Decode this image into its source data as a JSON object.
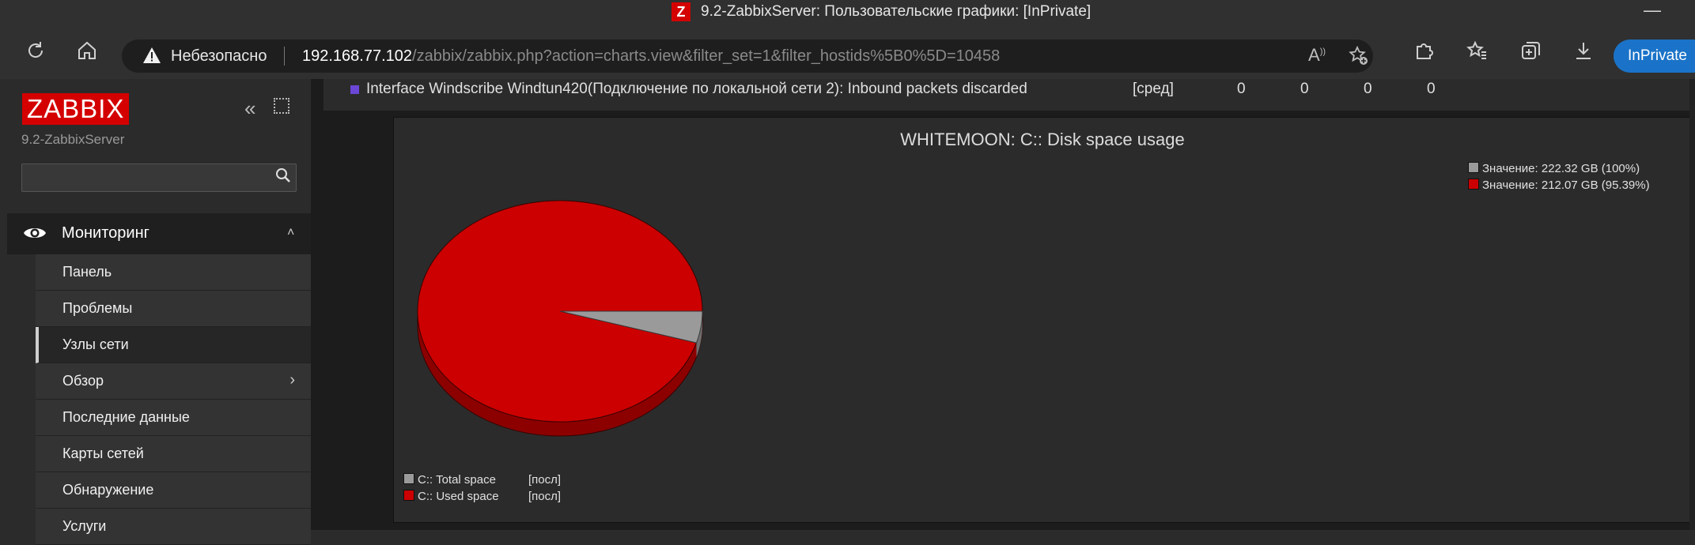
{
  "browser": {
    "window_title": "9.2-ZabbixServer: Пользовательские графики: [InPrivate]",
    "security_label": "Небезопасно",
    "url_host": "192.168.77.102",
    "url_path": "/zabbix/zabbix.php?action=charts.view&filter_set=1&filter_hostids%5B0%5D=10458",
    "inprivate_label": "InPrivate"
  },
  "sidebar": {
    "logo": "ZABBIX",
    "server_name": "9.2-ZabbixServer",
    "search_value": "",
    "section_label": "Мониторинг",
    "items": [
      {
        "label": "Панель"
      },
      {
        "label": "Проблемы"
      },
      {
        "label": "Узлы сети"
      },
      {
        "label": "Обзор"
      },
      {
        "label": "Последние данные"
      },
      {
        "label": "Карты сетей"
      },
      {
        "label": "Обнаружение"
      },
      {
        "label": "Услуги"
      }
    ]
  },
  "top_row": {
    "item_name": "Interface Windscribe Windtun420(Подключение по локальной сети 2): Inbound packets discarded",
    "aggregation": "[сред]",
    "values": [
      "0",
      "0",
      "0",
      "0"
    ]
  },
  "chart_data": {
    "type": "pie",
    "title": "WHITEMOON: C:: Disk space usage",
    "units": "GB",
    "series": [
      {
        "name": "C:: Total space",
        "legend_fn": "[посл]",
        "value": 222.32,
        "percent": 100,
        "value_label": "Значение: 222.32 GB (100%)",
        "color": "#9a9a9a"
      },
      {
        "name": "C:: Used space",
        "legend_fn": "[посл]",
        "value": 212.07,
        "percent": 95.39,
        "value_label": "Значение: 212.07 GB (95.39%)",
        "color": "#cc0000"
      }
    ]
  }
}
